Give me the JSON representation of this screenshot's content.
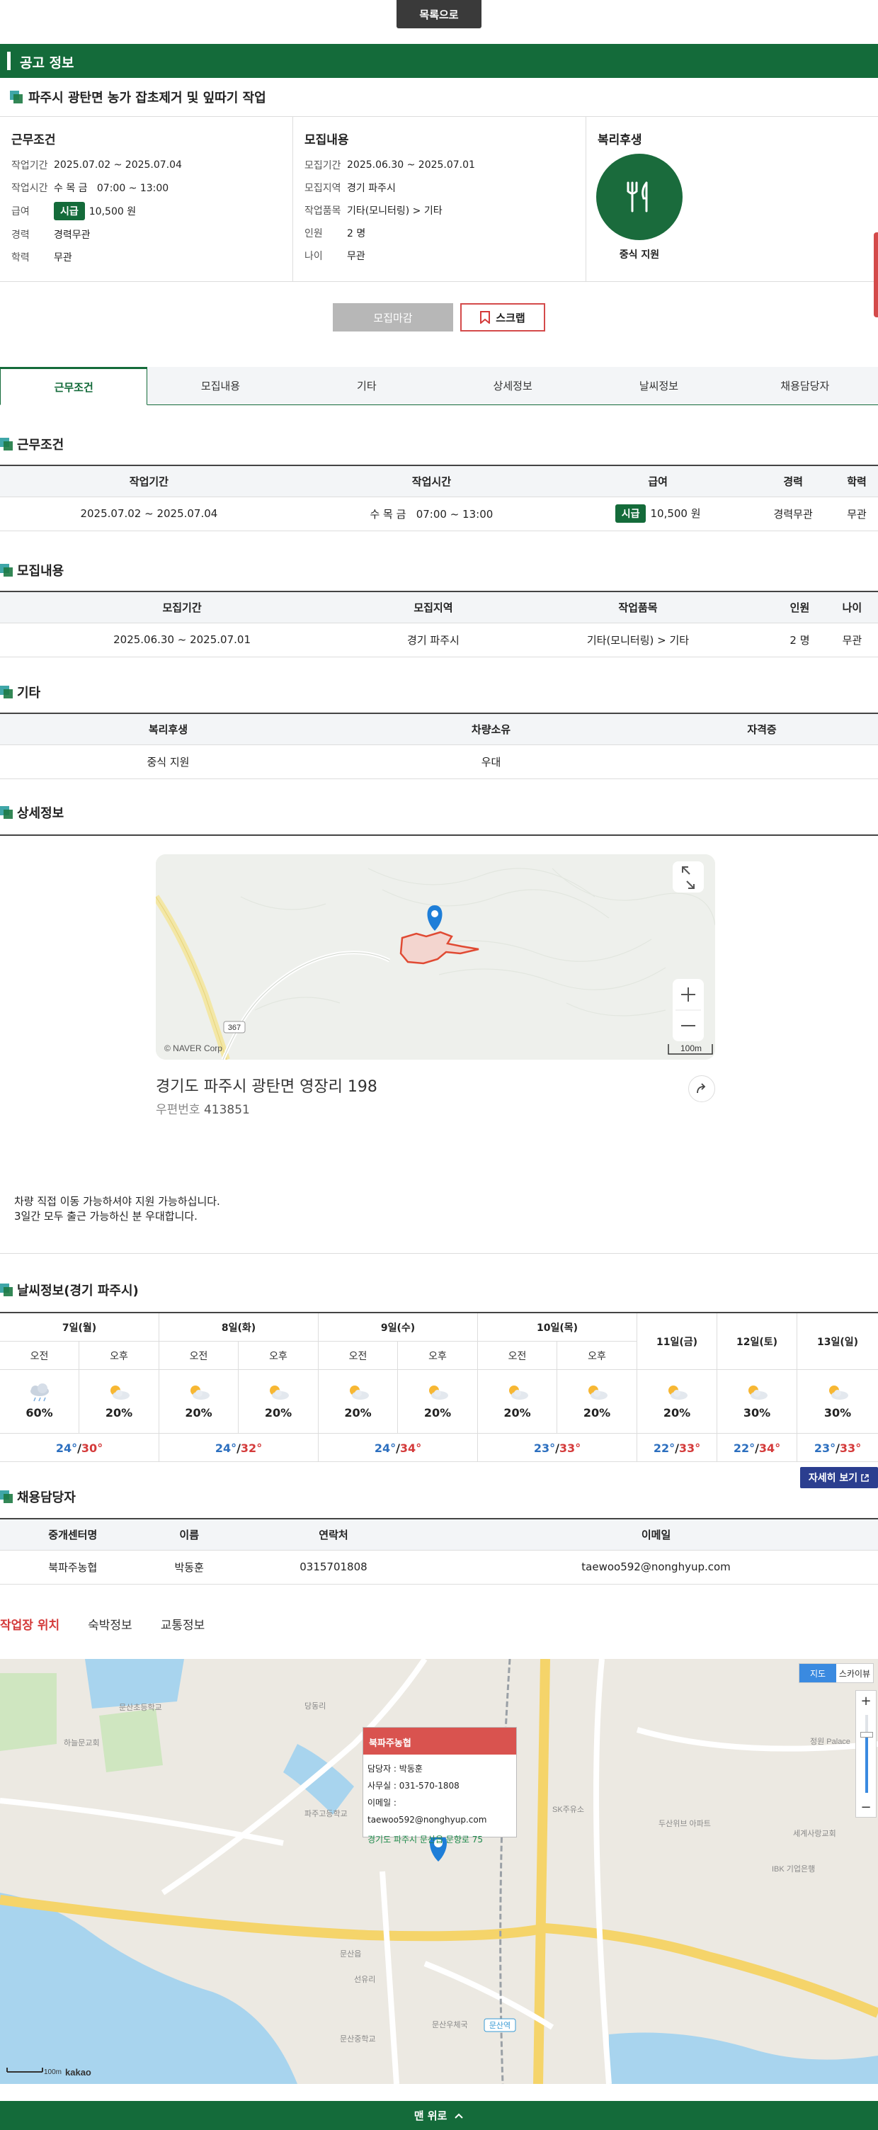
{
  "top": {
    "list_button": "목록으로"
  },
  "header": {
    "title": "공고 정보"
  },
  "job": {
    "title": "파주시 광탄면 농가 잡초제거 및 잎따기 작업"
  },
  "info": {
    "work": {
      "heading": "근무조건",
      "rows": [
        {
          "label": "작업기간",
          "value": "2025.07.02 ~ 2025.07.04"
        },
        {
          "label": "작업시간",
          "value": "수 목 금   07:00 ~ 13:00"
        },
        {
          "label": "급여",
          "badge": "시급",
          "value": "10,500 원"
        },
        {
          "label": "경력",
          "value": "경력무관"
        },
        {
          "label": "학력",
          "value": "무관"
        }
      ]
    },
    "recruit": {
      "heading": "모집내용",
      "rows": [
        {
          "label": "모집기간",
          "value": "2025.06.30 ~ 2025.07.01"
        },
        {
          "label": "모집지역",
          "value": "경기 파주시"
        },
        {
          "label": "작업품목",
          "value": "기타(모니터링) > 기타"
        },
        {
          "label": "인원",
          "value": "2 명"
        },
        {
          "label": "나이",
          "value": "무관"
        }
      ]
    },
    "welfare": {
      "heading": "복리후생",
      "item": "중식 지원"
    }
  },
  "actions": {
    "closed": "모집마감",
    "scrap": "스크랩"
  },
  "tabs": [
    "근무조건",
    "모집내용",
    "기타",
    "상세정보",
    "날씨정보",
    "채용담당자"
  ],
  "sections": {
    "work": {
      "title": "근무조건",
      "headers": [
        "작업기간",
        "작업시간",
        "급여",
        "경력",
        "학력"
      ],
      "row": {
        "period": "2025.07.02 ~ 2025.07.04",
        "time": "수 목 금   07:00 ~ 13:00",
        "pay_badge": "시급",
        "pay": "10,500 원",
        "career": "경력무관",
        "edu": "무관"
      }
    },
    "recruit": {
      "title": "모집내용",
      "headers": [
        "모집기간",
        "모집지역",
        "작업품목",
        "인원",
        "나이"
      ],
      "row": [
        "2025.06.30 ~ 2025.07.01",
        "경기 파주시",
        "기타(모니터링) > 기타",
        "2 명",
        "무관"
      ]
    },
    "etc": {
      "title": "기타",
      "headers": [
        "복리후생",
        "차량소유",
        "자격증"
      ],
      "row": [
        "중식 지원",
        "우대",
        ""
      ]
    },
    "detail": {
      "title": "상세정보",
      "map_copyright": "© NAVER Corp",
      "map_road": "367",
      "map_scale": "100m",
      "address": "경기도 파주시 광탄면 영장리 198",
      "zip_label": "우편번호",
      "zip": "413851",
      "note_line1": "차량 직접 이동 가능하셔야 지원 가능하십니다.",
      "note_line2": "3일간 모두 출근 가능하신 분 우대합니다."
    },
    "weather": {
      "title": "날씨정보(경기 파주시)",
      "am": "오전",
      "pm": "오후",
      "split_days": [
        {
          "label": "7일(월)",
          "am_pct": "60%",
          "pm_pct": "20%",
          "min": "24°",
          "max": "30°",
          "am_icon": "cloud-rain-icon"
        },
        {
          "label": "8일(화)",
          "am_pct": "20%",
          "pm_pct": "20%",
          "min": "24°",
          "max": "32°"
        },
        {
          "label": "9일(수)",
          "am_pct": "20%",
          "pm_pct": "20%",
          "min": "24°",
          "max": "34°"
        },
        {
          "label": "10일(목)",
          "am_pct": "20%",
          "pm_pct": "20%",
          "min": "23°",
          "max": "33°"
        }
      ],
      "single_days": [
        {
          "label": "11일(금)",
          "pct": "20%",
          "min": "22°",
          "max": "33°"
        },
        {
          "label": "12일(토)",
          "pct": "30%",
          "min": "22°",
          "max": "34°"
        },
        {
          "label": "13일(일)",
          "pct": "30%",
          "min": "23°",
          "max": "33°"
        }
      ],
      "more_button": "자세히 보기"
    },
    "contact": {
      "title": "채용담당자",
      "headers": [
        "중개센터명",
        "이름",
        "연락처",
        "이메일"
      ],
      "row": [
        "북파주농협",
        "박동훈",
        "0315701808",
        "taewoo592@nonghyup.com"
      ]
    }
  },
  "location_tabs": [
    "작업장 위치",
    "숙박정보",
    "교통정보"
  ],
  "map2": {
    "view_map": "지도",
    "view_sky": "스카이뷰",
    "popup_title": "북파주농협",
    "popup_manager": "담당자 : 박동훈",
    "popup_office": "사무실 : 031-570-1808",
    "popup_email": "이메일 : taewoo592@nonghyup.com",
    "popup_address": "경기도 파주시 문산읍 문향로 75",
    "scale": "100m",
    "brand": "kakao",
    "labels": [
      "문산역",
      "파주고등학교",
      "문산중학교",
      "SK주유소",
      "세계사랑교회",
      "문산읍",
      "선유리",
      "당동리",
      "정원 Palace",
      "IBK 기업은행",
      "문산초등학교",
      "하늘문교회",
      "두산위브 아파트",
      "문산우체국"
    ]
  },
  "footer": {
    "top_button": "맨 위로"
  },
  "colors": {
    "brand_green": "#146b3a",
    "accent_red": "#d43a3a",
    "min_temp": "#2c6fbf",
    "max_temp": "#d43a3a",
    "more_button": "#2b3e8f"
  }
}
